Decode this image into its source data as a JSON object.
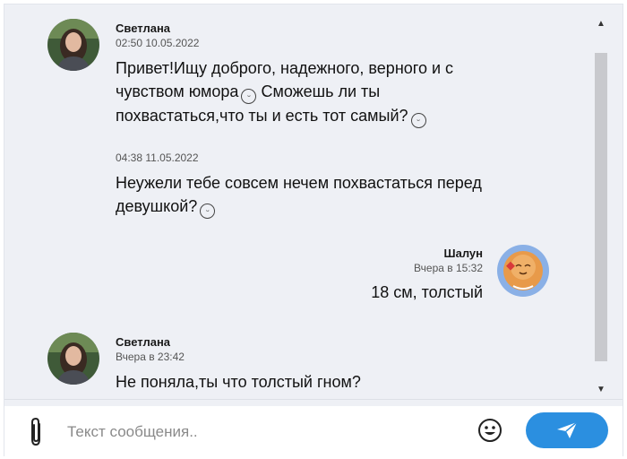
{
  "messages": [
    {
      "sender": "Светлана",
      "time": "02:50 10.05.2022",
      "text_lines": [
        "Привет!Ищу доброго, надежного, верного и с",
        "чувством юмора",
        " Сможешь ли ты",
        "похвастаться,что ты и есть тот самый?"
      ]
    },
    {
      "time": "04:38 11.05.2022",
      "text_lines": [
        "Неужели тебе совсем нечем похвастаться перед",
        "девушкой?"
      ]
    },
    {
      "sender": "Шалун",
      "time": "Вчера в 15:32",
      "text": "18 см, толстый"
    },
    {
      "sender": "Светлана",
      "time": "Вчера в 23:42",
      "text": "Не поняла,ты что толстый гном?"
    }
  ],
  "composer": {
    "placeholder": "Текст сообщения.."
  },
  "colors": {
    "chat_background": "#eef0f5",
    "send_button": "#2b8fe0",
    "scroll_thumb": "#c8c9cd"
  },
  "icons": [
    "paperclip-icon",
    "smile-icon",
    "send-arrow-icon",
    "scroll-up-arrow-icon",
    "scroll-down-arrow-icon"
  ]
}
